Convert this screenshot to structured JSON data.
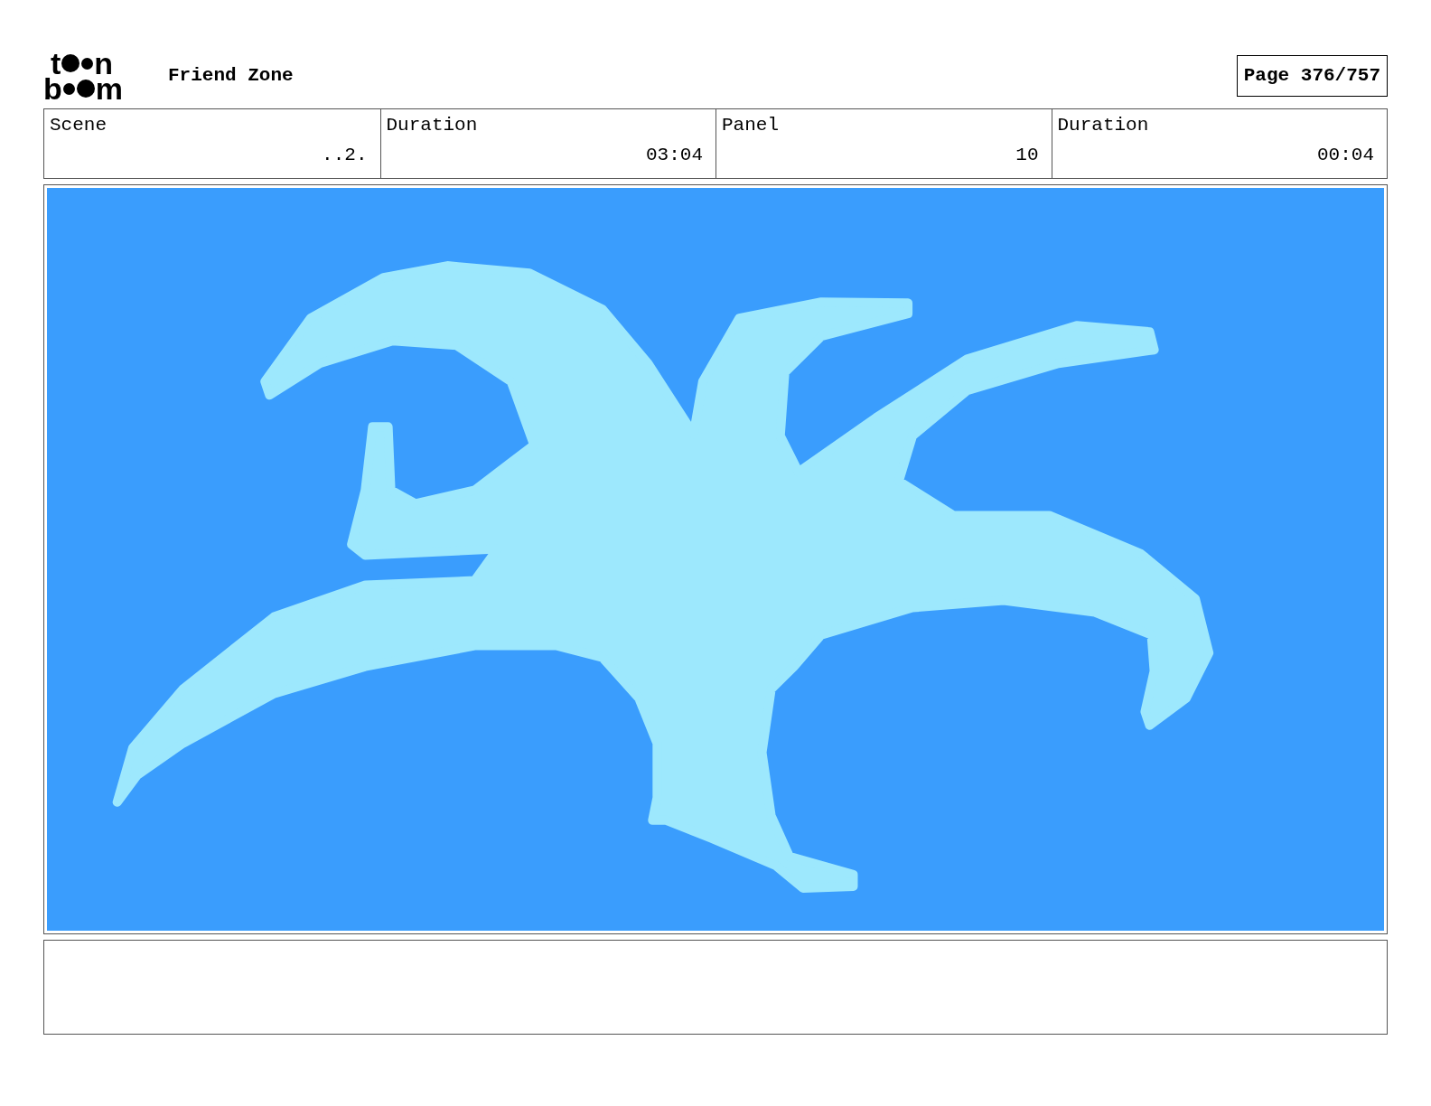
{
  "logo": {
    "letters": [
      "t",
      "n",
      "b",
      "m"
    ]
  },
  "title": "Friend Zone",
  "page": "Page 376/757",
  "fields": [
    {
      "label": "Scene",
      "value": "..2."
    },
    {
      "label": "Duration",
      "value": "03:04"
    },
    {
      "label": "Panel",
      "value": "10"
    },
    {
      "label": "Duration",
      "value": "00:04"
    }
  ]
}
